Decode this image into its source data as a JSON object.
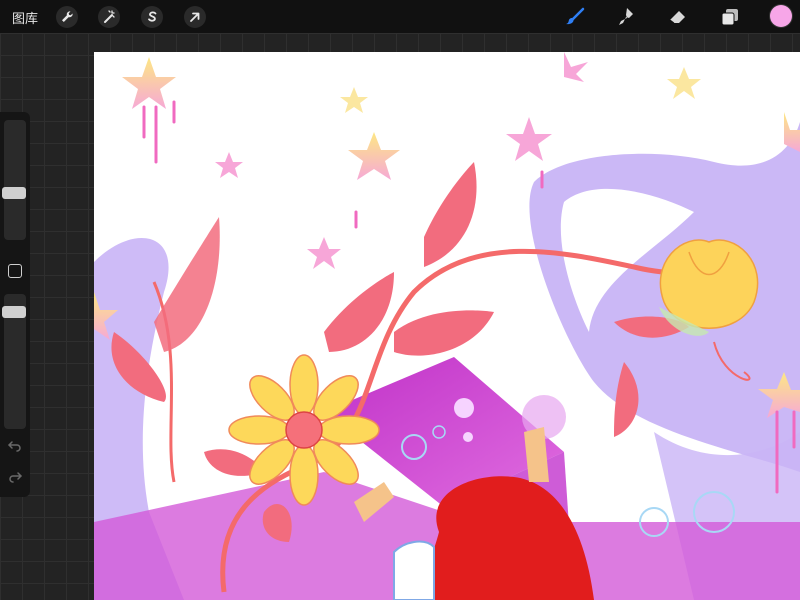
{
  "topbar": {
    "gallery_label": "图库",
    "left_tools": [
      {
        "name": "actions",
        "icon": "wrench-icon"
      },
      {
        "name": "adjustments",
        "icon": "magic-wand-icon"
      },
      {
        "name": "selection",
        "icon": "selection-s-icon"
      },
      {
        "name": "transform",
        "icon": "arrow-icon"
      }
    ],
    "right_tools": [
      {
        "name": "brush",
        "icon": "brush-icon",
        "active": true
      },
      {
        "name": "smudge",
        "icon": "smudge-icon"
      },
      {
        "name": "eraser",
        "icon": "eraser-icon"
      },
      {
        "name": "layers",
        "icon": "layers-icon"
      }
    ],
    "active_color": "#f7a6e8"
  },
  "sidebar": {
    "brush_size_level": 0.62,
    "opacity_level": 0.1,
    "undo_icon": "undo-icon",
    "redo_icon": "redo-icon"
  },
  "canvas": {
    "artwork": "illustration"
  },
  "colors": {
    "accent_blue": "#2f7ff5",
    "toolbar_bg": "#111111",
    "workspace_bg": "#232323"
  }
}
